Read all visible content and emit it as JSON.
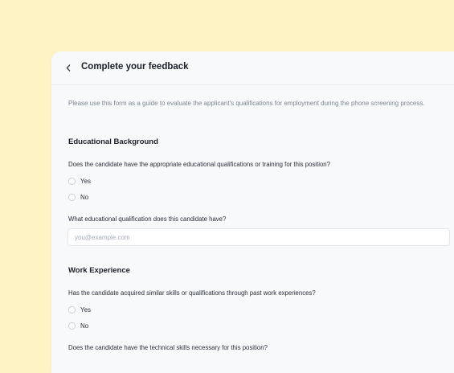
{
  "header": {
    "title": "Complete your feedback",
    "back_icon": "chevron-left-icon"
  },
  "intro": "Please use this form as a guide to evaluate the applicant's qualifications for employment during the phone screening process.",
  "sections": [
    {
      "title": "Educational Background",
      "questions": [
        {
          "text": "Does the candidate have the appropriate educational qualifications or training for this position?",
          "options": [
            "Yes",
            "No"
          ]
        },
        {
          "text": "What educational qualification does this candidate have?",
          "input_value": "",
          "input_placeholder": "you@example.com"
        }
      ]
    },
    {
      "title": "Work Experience",
      "questions": [
        {
          "text": "Has the candidate acquired similar skills or qualifications through past work experiences?",
          "options": [
            "Yes",
            "No"
          ]
        },
        {
          "text": "Does the candidate have the technical skills necessary for this position?"
        }
      ]
    }
  ],
  "colors": {
    "background": "#fdf2c4",
    "card": "#f8f9fb",
    "text": "#1b1f2a",
    "muted": "#7d8593"
  }
}
